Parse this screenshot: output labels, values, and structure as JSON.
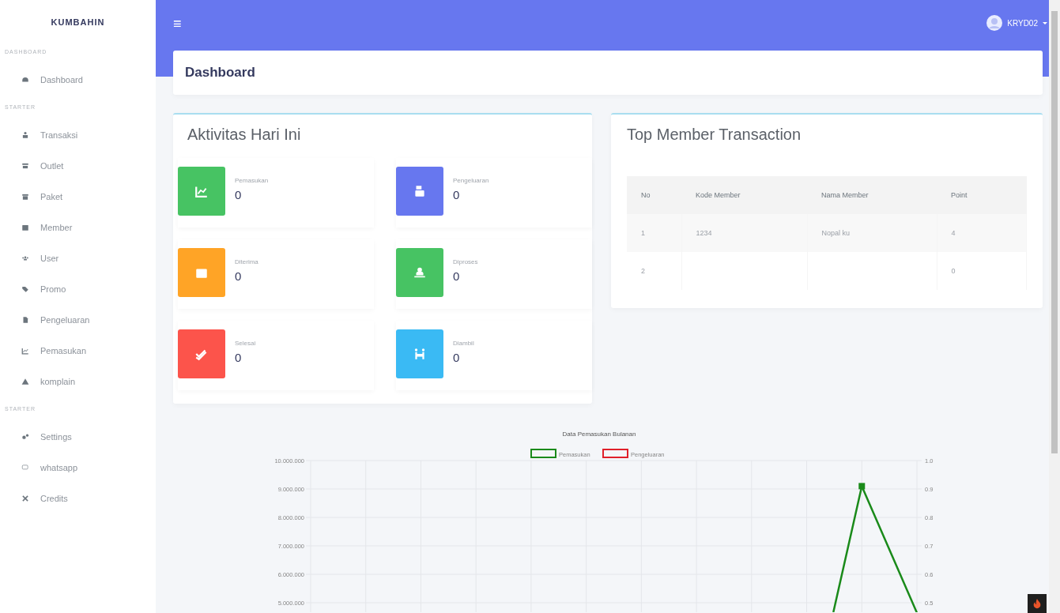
{
  "sidebar": {
    "brand": "KUMBAHIN",
    "sections": [
      {
        "heading": "DASHBOARD",
        "items": [
          {
            "label": "Dashboard"
          }
        ]
      },
      {
        "heading": "STARTER",
        "items": [
          {
            "label": "Transaksi"
          },
          {
            "label": "Outlet"
          },
          {
            "label": "Paket"
          },
          {
            "label": "Member"
          },
          {
            "label": "User"
          },
          {
            "label": "Promo"
          },
          {
            "label": "Pengeluaran"
          },
          {
            "label": "Pemasukan"
          },
          {
            "label": "komplain"
          }
        ]
      },
      {
        "heading": "STARTER",
        "items": [
          {
            "label": "Settings"
          },
          {
            "label": "whatsapp"
          },
          {
            "label": "Credits"
          }
        ]
      }
    ]
  },
  "navbar": {
    "menu_icon": "≡",
    "user": "KRYD02"
  },
  "page_title": "Dashboard",
  "activity": {
    "title": "Aktivitas Hari Ini",
    "stats": [
      {
        "label": "Pemasukan",
        "value": "0",
        "color": "#47c363"
      },
      {
        "label": "Pengeluaran",
        "value": "0",
        "color": "#6777ef"
      },
      {
        "label": "Diterima",
        "value": "0",
        "color": "#ffa426"
      },
      {
        "label": "Diproses",
        "value": "0",
        "color": "#47c363"
      },
      {
        "label": "Selesai",
        "value": "0",
        "color": "#fc544b"
      },
      {
        "label": "Diambil",
        "value": "0",
        "color": "#3abaf4"
      }
    ]
  },
  "top_members": {
    "title": "Top Member Transaction",
    "columns": [
      "No",
      "Kode Member",
      "Nama Member",
      "Point"
    ],
    "rows": [
      [
        "1",
        "1234",
        "Nopal ku",
        "4"
      ],
      [
        "2",
        "",
        "",
        "0"
      ]
    ]
  },
  "chart": {
    "title": "Data Pemasukan Bulanan",
    "legend": [
      {
        "name": "Pemasukan",
        "color": "#1a8a1a"
      },
      {
        "name": "Pengeluaran",
        "color": "#e0202a"
      }
    ],
    "left_axis_labels": [
      "10.000.000",
      "9.000.000",
      "8.000.000",
      "7.000.000",
      "6.000.000",
      "5.000.000"
    ],
    "right_axis_labels": [
      "1.0",
      "0.9",
      "0.8",
      "0.7",
      "0.6",
      "0.5"
    ]
  }
}
